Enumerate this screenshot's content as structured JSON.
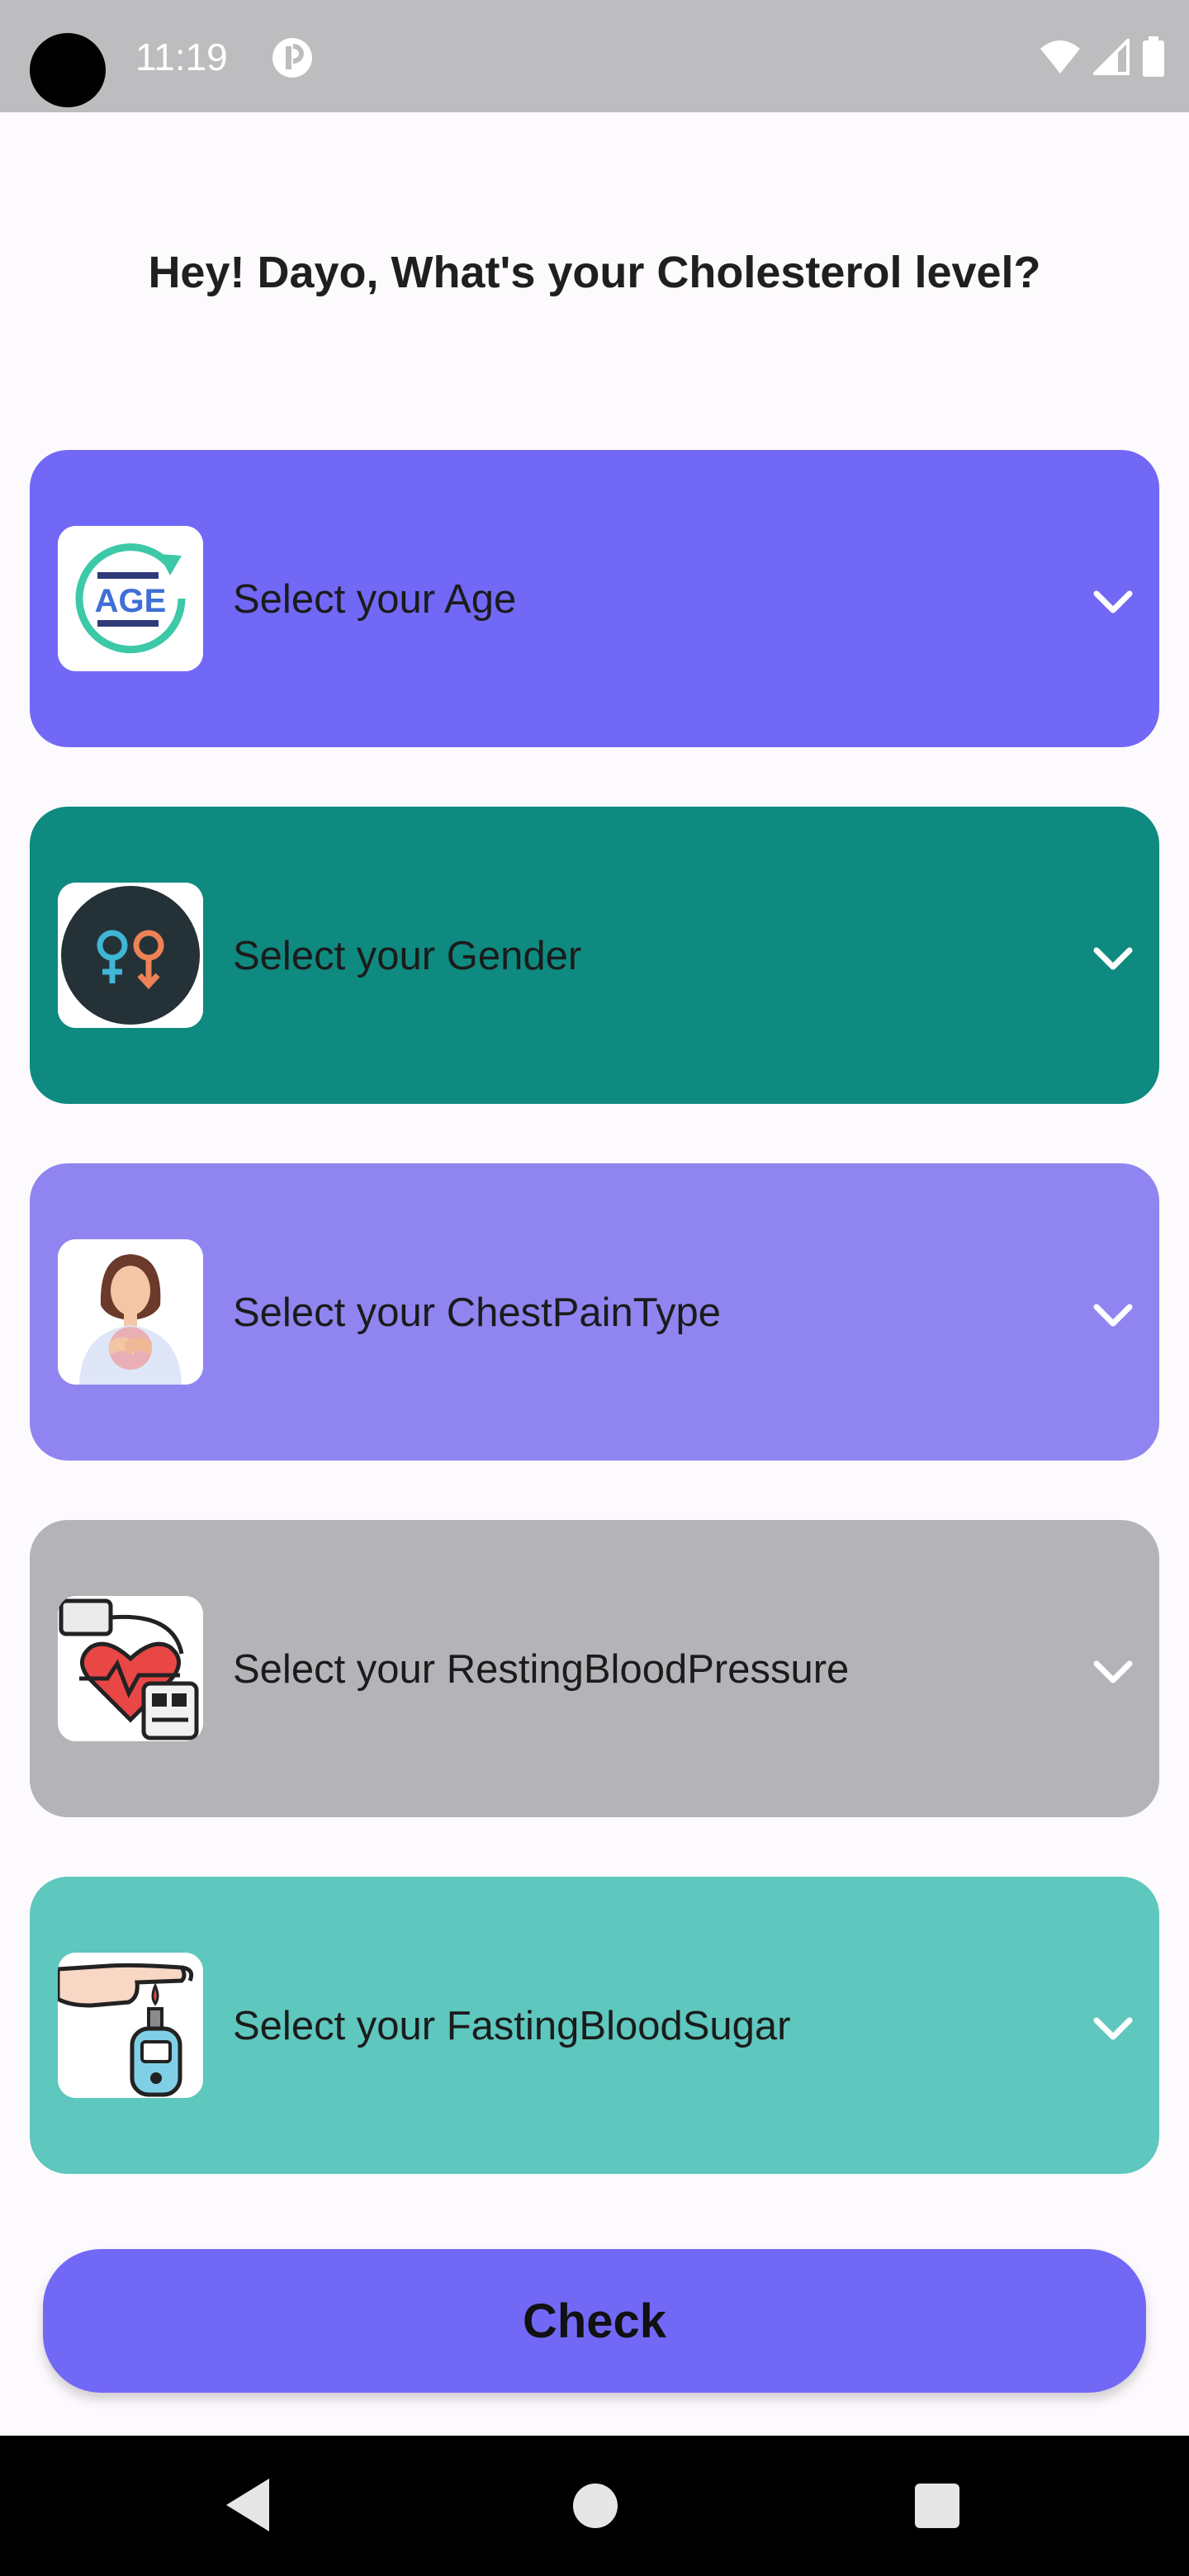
{
  "status_bar": {
    "time": "11:19",
    "icons": [
      "camera-punch-hole",
      "app-notification-icon",
      "wifi-icon",
      "cell-signal-icon",
      "battery-icon"
    ]
  },
  "header": {
    "title": "Hey! Dayo, What's your Cholesterol level?"
  },
  "cards": [
    {
      "label": "Select your Age",
      "icon": "age-icon",
      "color": "#7268f6"
    },
    {
      "label": "Select your Gender",
      "icon": "gender-icon",
      "color": "#0f8a80"
    },
    {
      "label": "Select your ChestPainType",
      "icon": "chest-pain-icon",
      "color": "#9085f0"
    },
    {
      "label": "Select your RestingBloodPressure",
      "icon": "blood-pressure-icon",
      "color": "#b4b3b7"
    },
    {
      "label": "Select your FastingBloodSugar",
      "icon": "blood-sugar-icon",
      "color": "#5ec7be"
    }
  ],
  "check_button": {
    "label": "Check",
    "color": "#7268f6"
  },
  "nav_bar": {
    "icons": [
      "back-icon",
      "home-icon",
      "recents-icon"
    ]
  }
}
